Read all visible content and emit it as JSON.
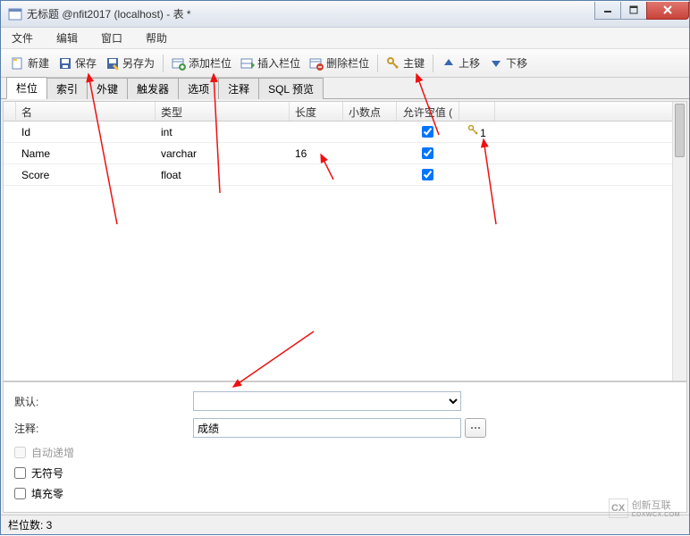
{
  "window": {
    "title": "无标题 @nfit2017 (localhost) - 表 *"
  },
  "menubar": {
    "file": "文件",
    "edit": "编辑",
    "window": "窗口",
    "help": "帮助"
  },
  "toolbar": {
    "new": "新建",
    "save": "保存",
    "save_as": "另存为",
    "add_field": "添加栏位",
    "insert_field": "插入栏位",
    "delete_field": "删除栏位",
    "primary_key": "主键",
    "move_up": "上移",
    "move_down": "下移"
  },
  "tabs": {
    "fields": "栏位",
    "indexes": "索引",
    "foreign_keys": "外键",
    "triggers": "触发器",
    "options": "选项",
    "comment": "注释",
    "sql_preview": "SQL 预览"
  },
  "grid": {
    "headers": {
      "name": "名",
      "type": "类型",
      "length": "长度",
      "decimals": "小数点",
      "allow_null": "允许空值 (",
      "key": ""
    },
    "rows": [
      {
        "name": "Id",
        "type": "int",
        "length": "",
        "decimals": "",
        "allow_null": true,
        "key": "1"
      },
      {
        "name": "Name",
        "type": "varchar",
        "length": "16",
        "decimals": "",
        "allow_null": true,
        "key": ""
      },
      {
        "name": "Score",
        "type": "float",
        "length": "",
        "decimals": "",
        "allow_null": true,
        "key": ""
      }
    ]
  },
  "props": {
    "default_label": "默认:",
    "default_value": "",
    "comment_label": "注释:",
    "comment_value": "成绩",
    "auto_increment": "自动递增",
    "unsigned": "无符号",
    "zerofill": "填充零"
  },
  "statusbar": {
    "text": "栏位数: 3"
  },
  "watermark": {
    "brand": "创新互联",
    "sub": "CDXWCX.COM"
  }
}
